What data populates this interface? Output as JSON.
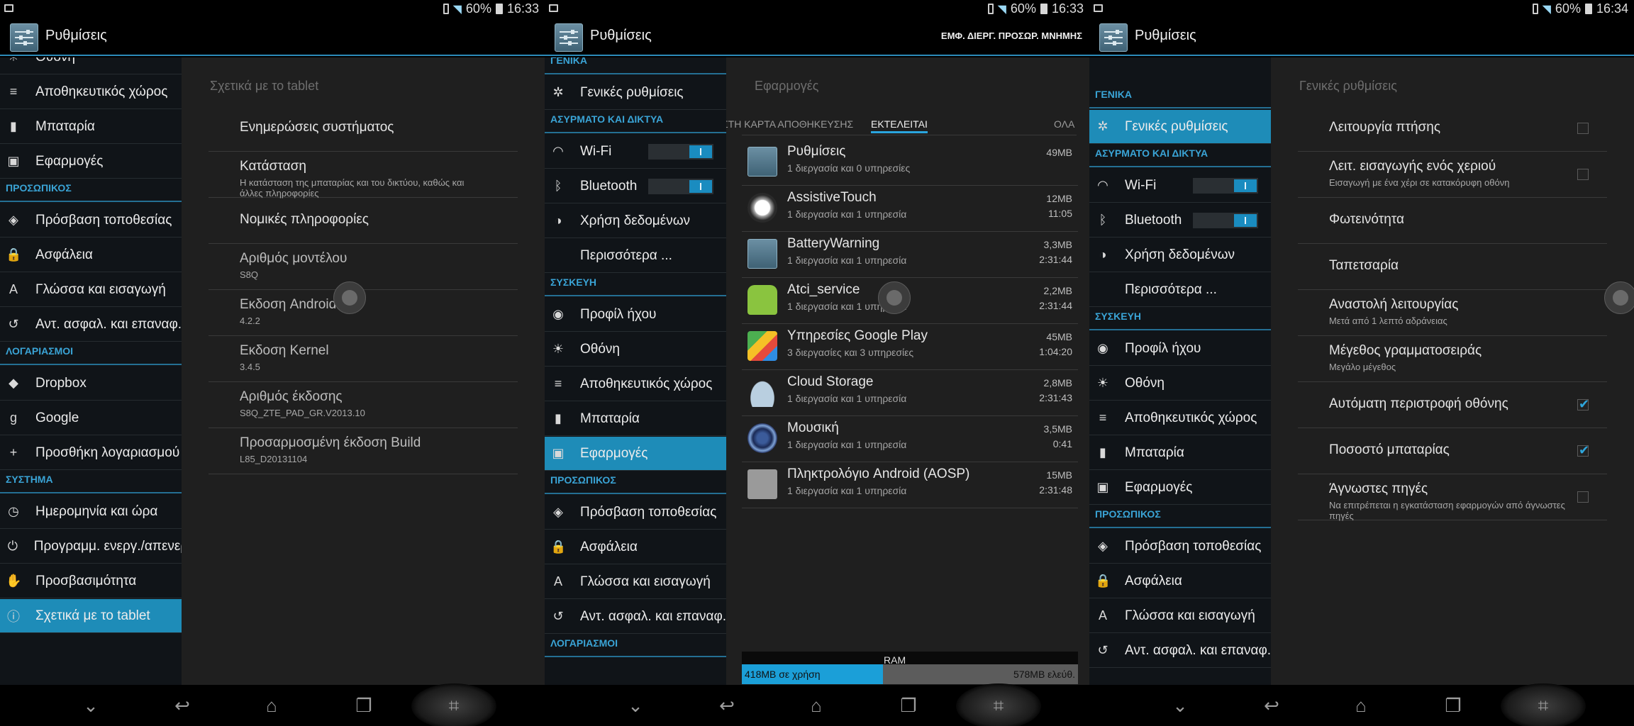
{
  "status_bar": [
    {
      "battery": "60%",
      "time": "16:33"
    },
    {
      "battery": "60%",
      "time": "16:33"
    },
    {
      "battery": "60%",
      "time": "16:34"
    }
  ],
  "app_title": "Ρυθμίσεις",
  "colors": {
    "accent": "#1e8cb8",
    "header_text": "#3aa4d6",
    "background": "#1f1f1f",
    "sidebar": "#101418"
  },
  "panel1": {
    "sidebar": [
      {
        "kind": "item",
        "icon": "display-icon",
        "glyph": "☀",
        "label": "Οθόνη"
      },
      {
        "kind": "item",
        "icon": "storage-icon",
        "glyph": "≡",
        "label": "Αποθηκευτικός χώρος"
      },
      {
        "kind": "item",
        "icon": "battery-icon",
        "glyph": "▮",
        "label": "Μπαταρία"
      },
      {
        "kind": "item",
        "icon": "apps-icon",
        "glyph": "▣",
        "label": "Εφαρμογές"
      },
      {
        "kind": "header",
        "label": "ΠΡΟΣΩΠΙΚΟΣ"
      },
      {
        "kind": "item",
        "icon": "location-icon",
        "glyph": "◈",
        "label": "Πρόσβαση τοποθεσίας"
      },
      {
        "kind": "item",
        "icon": "lock-icon",
        "glyph": "🔒",
        "label": "Ασφάλεια"
      },
      {
        "kind": "item",
        "icon": "language-icon",
        "glyph": "A",
        "label": "Γλώσσα και εισαγωγή"
      },
      {
        "kind": "item",
        "icon": "backup-icon",
        "glyph": "↺",
        "label": "Αντ. ασφαλ. και επαναφ."
      },
      {
        "kind": "header",
        "label": "ΛΟΓΑΡΙΑΣΜΟΙ"
      },
      {
        "kind": "item",
        "icon": "dropbox-icon",
        "glyph": "◆",
        "label": "Dropbox"
      },
      {
        "kind": "item",
        "icon": "google-icon",
        "glyph": "g",
        "label": "Google"
      },
      {
        "kind": "item",
        "icon": "add-icon",
        "glyph": "+",
        "label": "Προσθήκη λογαριασμού"
      },
      {
        "kind": "header",
        "label": "ΣΥΣΤΗΜΑ"
      },
      {
        "kind": "item",
        "icon": "clock-icon",
        "glyph": "◷",
        "label": "Ημερομηνία και ώρα"
      },
      {
        "kind": "item",
        "icon": "power-icon",
        "glyph": "⏻",
        "label": "Προγραμμ. ενεργ./απενεργ."
      },
      {
        "kind": "item",
        "icon": "hand-icon",
        "glyph": "✋",
        "label": "Προσβασιμότητα"
      },
      {
        "kind": "item",
        "icon": "info-icon",
        "glyph": "ⓘ",
        "label": "Σχετικά με το tablet",
        "selected": true
      }
    ],
    "content_title": "Σχετικά με το tablet",
    "items": [
      {
        "title": "Ενημερώσεις συστήματος",
        "summary": ""
      },
      {
        "title": "Κατάσταση",
        "summary": "Η κατάσταση της μπαταρίας και του δικτύου, καθώς και άλλες πληροφορίες"
      },
      {
        "title": "Νομικές πληροφορίες",
        "summary": ""
      },
      {
        "title": "Αριθμός μοντέλου",
        "summary": "S8Q",
        "dim": true
      },
      {
        "title": "Εκδοση Android",
        "summary": "4.2.2",
        "dim": true
      },
      {
        "title": "Εκδοση Kernel",
        "summary": "3.4.5",
        "dim": true
      },
      {
        "title": "Αριθμός έκδοσης",
        "summary": "S8Q_ZTE_PAD_GR.V2013.10",
        "dim": true
      },
      {
        "title": "Προσαρμοσμένη έκδοση Build",
        "summary": "L85_D20131104",
        "dim": true
      }
    ]
  },
  "panel2": {
    "action_label": "ΕΜΦ. ΔΙΕΡΓ. ΠΡΟΣΩΡ. ΜΝΗΜΗΣ",
    "sidebar": [
      {
        "kind": "header",
        "label": "ΓΕΝΙΚΑ"
      },
      {
        "kind": "item",
        "icon": "gear-icon",
        "glyph": "✲",
        "label": "Γενικές ρυθμίσεις"
      },
      {
        "kind": "header",
        "label": "ΑΣΥΡΜΑΤΟ ΚΑΙ ΔΙΚΤΥΑ"
      },
      {
        "kind": "item",
        "icon": "wifi-icon",
        "glyph": "◠",
        "label": "Wi-Fi",
        "toggle": true
      },
      {
        "kind": "item",
        "icon": "bluetooth-icon",
        "glyph": "ᛒ",
        "label": "Bluetooth",
        "toggle": true
      },
      {
        "kind": "item",
        "icon": "data-usage-icon",
        "glyph": "◑",
        "label": "Χρήση δεδομένων"
      },
      {
        "kind": "item",
        "icon": "",
        "glyph": "",
        "label": "Περισσότερα ..."
      },
      {
        "kind": "header",
        "label": "ΣΥΣΚΕΥΗ"
      },
      {
        "kind": "item",
        "icon": "sound-profile-icon",
        "glyph": "◉",
        "label": "Προφίλ ήχου"
      },
      {
        "kind": "item",
        "icon": "display-icon",
        "glyph": "☀",
        "label": "Οθόνη"
      },
      {
        "kind": "item",
        "icon": "storage-icon",
        "glyph": "≡",
        "label": "Αποθηκευτικός χώρος"
      },
      {
        "kind": "item",
        "icon": "battery-icon",
        "glyph": "▮",
        "label": "Μπαταρία"
      },
      {
        "kind": "item",
        "icon": "apps-icon",
        "glyph": "▣",
        "label": "Εφαρμογές",
        "selected": true
      },
      {
        "kind": "header",
        "label": "ΠΡΟΣΩΠΙΚΟΣ"
      },
      {
        "kind": "item",
        "icon": "location-icon",
        "glyph": "◈",
        "label": "Πρόσβαση τοποθεσίας"
      },
      {
        "kind": "item",
        "icon": "lock-icon",
        "glyph": "🔒",
        "label": "Ασφάλεια"
      },
      {
        "kind": "item",
        "icon": "language-icon",
        "glyph": "A",
        "label": "Γλώσσα και εισαγωγή"
      },
      {
        "kind": "item",
        "icon": "backup-icon",
        "glyph": "↺",
        "label": "Αντ. ασφαλ. και επαναφ."
      },
      {
        "kind": "header",
        "label": "ΛΟΓΑΡΙΑΣΜΟΙ"
      }
    ],
    "content_title": "Εφαρμογές",
    "tabs": [
      {
        "label": "ΣΤΗ ΚΑΡΤΑ ΑΠΟΘΗΚΕΥΣΗΣ"
      },
      {
        "label": "ΕΚΤΕΛΕΙΤΑΙ",
        "active": true
      },
      {
        "label": "ΟΛΑ"
      }
    ],
    "processes": [
      {
        "name": "Ρυθμίσεις",
        "sub": "1 διεργασία και 0 υπηρεσίες",
        "mem": "49MB",
        "time": "",
        "icon": "settings-app-icon"
      },
      {
        "name": "AssistiveTouch",
        "sub": "1 διεργασία και 1 υπηρεσία",
        "mem": "12MB",
        "time": "11:05",
        "icon": "assistive-touch-icon"
      },
      {
        "name": "BatteryWarning",
        "sub": "1 διεργασία και 1 υπηρεσία",
        "mem": "3,3MB",
        "time": "2:31:44",
        "icon": "settings-app-icon"
      },
      {
        "name": "Atci_service",
        "sub": "1 διεργασία και 1 υπηρεσία",
        "mem": "2,2MB",
        "time": "2:31:44",
        "icon": "android-robot-icon"
      },
      {
        "name": "Υπηρεσίες Google Play",
        "sub": "3 διεργασίες και 3 υπηρεσίες",
        "mem": "45MB",
        "time": "1:04:20",
        "icon": "puzzle-piece-icon"
      },
      {
        "name": "Cloud Storage",
        "sub": "1 διεργασία και 1 υπηρεσία",
        "mem": "2,8MB",
        "time": "2:31:43",
        "icon": "cloud-icon"
      },
      {
        "name": "Μουσική",
        "sub": "1 διεργασία και 1 υπηρεσία",
        "mem": "3,5MB",
        "time": "0:41",
        "icon": "speaker-icon"
      },
      {
        "name": "Πληκτρολόγιο Android (AOSP)",
        "sub": "1 διεργασία και 1 υπηρεσία",
        "mem": "15MB",
        "time": "2:31:48",
        "icon": "keyboard-icon"
      }
    ],
    "ram": {
      "label": "RAM",
      "used": "418MB σε χρήση",
      "free": "578MB ελεύθ.",
      "used_fraction": 0.42
    }
  },
  "panel3": {
    "sidebar": [
      {
        "kind": "header",
        "label": "ΓΕΝΙΚΑ"
      },
      {
        "kind": "item",
        "icon": "gear-icon",
        "glyph": "✲",
        "label": "Γενικές ρυθμίσεις",
        "selected": true
      },
      {
        "kind": "header",
        "label": "ΑΣΥΡΜΑΤΟ ΚΑΙ ΔΙΚΤΥΑ"
      },
      {
        "kind": "item",
        "icon": "wifi-icon",
        "glyph": "◠",
        "label": "Wi-Fi",
        "toggle": true
      },
      {
        "kind": "item",
        "icon": "bluetooth-icon",
        "glyph": "ᛒ",
        "label": "Bluetooth",
        "toggle": true
      },
      {
        "kind": "item",
        "icon": "data-usage-icon",
        "glyph": "◑",
        "label": "Χρήση δεδομένων"
      },
      {
        "kind": "item",
        "icon": "",
        "glyph": "",
        "label": "Περισσότερα ..."
      },
      {
        "kind": "header",
        "label": "ΣΥΣΚΕΥΗ"
      },
      {
        "kind": "item",
        "icon": "sound-profile-icon",
        "glyph": "◉",
        "label": "Προφίλ ήχου"
      },
      {
        "kind": "item",
        "icon": "display-icon",
        "glyph": "☀",
        "label": "Οθόνη"
      },
      {
        "kind": "item",
        "icon": "storage-icon",
        "glyph": "≡",
        "label": "Αποθηκευτικός χώρος"
      },
      {
        "kind": "item",
        "icon": "battery-icon",
        "glyph": "▮",
        "label": "Μπαταρία"
      },
      {
        "kind": "item",
        "icon": "apps-icon",
        "glyph": "▣",
        "label": "Εφαρμογές"
      },
      {
        "kind": "header",
        "label": "ΠΡΟΣΩΠΙΚΟΣ"
      },
      {
        "kind": "item",
        "icon": "location-icon",
        "glyph": "◈",
        "label": "Πρόσβαση τοποθεσίας"
      },
      {
        "kind": "item",
        "icon": "lock-icon",
        "glyph": "🔒",
        "label": "Ασφάλεια"
      },
      {
        "kind": "item",
        "icon": "language-icon",
        "glyph": "A",
        "label": "Γλώσσα και εισαγωγή"
      },
      {
        "kind": "item",
        "icon": "backup-icon",
        "glyph": "↺",
        "label": "Αντ. ασφαλ. και επαναφ."
      }
    ],
    "content_title": "Γενικές ρυθμίσεις",
    "items": [
      {
        "title": "Λειτουργία πτήσης",
        "summary": "",
        "checkbox": "off"
      },
      {
        "title": "Λειτ. εισαγωγής ενός χεριού",
        "summary": "Εισαγωγή με ένα χέρι σε κατακόρυφη οθόνη",
        "checkbox": "off"
      },
      {
        "title": "Φωτεινότητα",
        "summary": ""
      },
      {
        "title": "Ταπετσαρία",
        "summary": ""
      },
      {
        "title": "Αναστολή λειτουργίας",
        "summary": "Μετά από 1 λεπτό αδράνειας"
      },
      {
        "title": "Μέγεθος γραμματοσειράς",
        "summary": "Μεγάλο μέγεθος"
      },
      {
        "title": "Αυτόματη περιστροφή οθόνης",
        "summary": "",
        "checkbox": "on"
      },
      {
        "title": "Ποσοστό μπαταρίας",
        "summary": "",
        "checkbox": "on"
      },
      {
        "title": "Άγνωστες πηγές",
        "summary": "Να επιτρέπεται η εγκατάσταση εφαρμογών από άγνωστες πηγές",
        "checkbox": "off"
      }
    ]
  },
  "nav_icons": [
    "hide-keyboard-icon",
    "back-icon",
    "home-icon",
    "recent-apps-icon",
    "screenshot-icon"
  ]
}
